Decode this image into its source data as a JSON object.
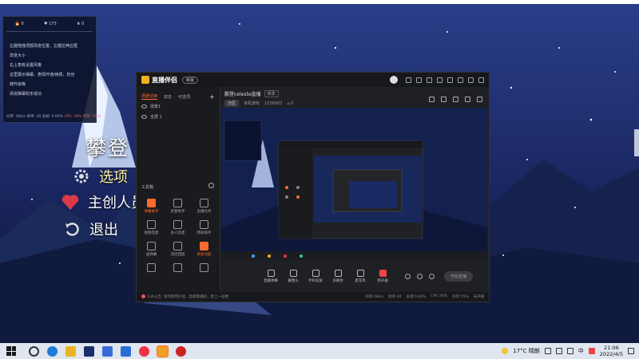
{
  "game": {
    "title": "攀登",
    "menu": [
      {
        "label": "选项",
        "icon": "gear-icon"
      },
      {
        "label": "主创人员",
        "icon": "heart-icon"
      },
      {
        "label": "退出",
        "icon": "back-arrow-icon"
      }
    ]
  },
  "overlay": {
    "stats": [
      {
        "icon": "fire-icon",
        "value": "0"
      },
      {
        "icon": "heart-icon",
        "value": "173"
      },
      {
        "icon": "crown-icon",
        "value": "0"
      }
    ],
    "messages": [
      "左键拖拽顶部改变位置，左键拉伸边框",
      "改变大小",
      "右上角有设置风格",
      "这里展示弹幕、表情开通/续费、粉丝",
      "牌升级等",
      "添加弹幕助手成功"
    ],
    "footer_left": "码率: 0kb/s 帧率: 30 丢帧: 0.00%",
    "footer_warn": "CPU: 36% 内存: 55%"
  },
  "app": {
    "name": "直播伴侣",
    "version_badge": "新版",
    "title_icons": [
      "avatar",
      "mail-icon",
      "heart-icon",
      "save-icon",
      "shirt-icon",
      "menu-icon",
      "minimize-icon",
      "maximize-icon",
      "close-icon"
    ],
    "left_tabs": [
      "场景切换",
      "双击",
      "可选项"
    ],
    "scenes": [
      "场景1",
      "全屏 1"
    ],
    "tools_header": "工具箱",
    "tools": [
      {
        "label": "弹幕助手",
        "hot": true
      },
      {
        "label": "房管助手",
        "hot": false
      },
      {
        "label": "主播任务",
        "hot": false
      },
      {
        "label": "视频连麦",
        "hot": false
      },
      {
        "label": "多人连麦",
        "hot": false
      },
      {
        "label": "特效助手",
        "hot": false
      },
      {
        "label": "送弹幕",
        "hot": false
      },
      {
        "label": "流控回放",
        "hot": false
      },
      {
        "label": "更多功能",
        "hot": true
      },
      {
        "label": "",
        "hot": false
      },
      {
        "label": "",
        "hot": false
      },
      {
        "label": "",
        "hot": false
      }
    ],
    "stream_title": "鹏登celeste直播",
    "edit_label": "修改",
    "part_button": "分区",
    "part_name": "单机游戏",
    "room_id": "1036003",
    "viewers": "0",
    "controls": [
      {
        "label": "直播弹幕",
        "red": false
      },
      {
        "label": "摄像头",
        "red": false
      },
      {
        "label": "手机投屏",
        "red": false
      },
      {
        "label": "多媒体",
        "red": false
      },
      {
        "label": "麦克风",
        "red": false
      },
      {
        "label": "扬声器",
        "red": true
      }
    ],
    "start_live": "开始直播",
    "status_notice": "头条公告: 请勿使用外挂，直播需遵纪，更上一层楼",
    "status_stats": [
      "码率:0kb/s",
      "帧率:30",
      "丢帧:0.00%",
      "CPU:36%",
      "内存:55%",
      "未开播"
    ]
  },
  "taskbar": {
    "weather": "17°C 晴朗",
    "time": "21:06",
    "date": "2022/4/5",
    "ime": "中"
  },
  "colors": {
    "accent": "#ff6a2f",
    "panel": "#1f2024"
  }
}
